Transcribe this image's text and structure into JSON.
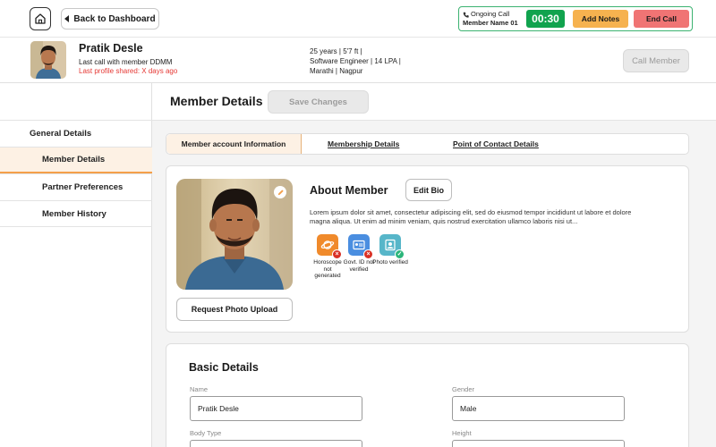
{
  "topbar": {
    "back_label": "Back to Dashboard",
    "call": {
      "status": "Ongoing Call",
      "member_name": "Member Name 01",
      "timer": "00:30",
      "add_notes_label": "Add Notes",
      "end_call_label": "End Call"
    }
  },
  "member": {
    "name": "Pratik Desle",
    "last_call": "Last call with member DDMM",
    "last_shared": "Last profile shared: X days ago",
    "stats_line1": "25 years | 5'7 ft |",
    "stats_line2": "Software Engineer | 14 LPA |",
    "stats_line3": "Marathi | Nagpur",
    "call_member_label": "Call Member"
  },
  "sidebar": {
    "items": [
      {
        "label": "General Details"
      },
      {
        "label": "Member Details"
      },
      {
        "label": "Partner Preferences"
      },
      {
        "label": "Member History"
      }
    ]
  },
  "main": {
    "title": "Member Details",
    "save_label": "Save Changes",
    "tabs": [
      {
        "label": "Member account Information"
      },
      {
        "label": "Membership Details"
      },
      {
        "label": "Point of Contact Details"
      }
    ],
    "about": {
      "title": "About Member",
      "edit_bio_label": "Edit Bio",
      "request_upload_label": "Request Photo Upload",
      "bio": "Lorem ipsum dolor sit amet, consectetur adipiscing elit, sed do eiusmod tempor incididunt ut labore et dolore magna aliqua. Ut enim ad minim veniam, quis nostrud exercitation ullamco laboris nisi ut...",
      "badges": [
        {
          "label": "Horoscope not generated",
          "icon": "horoscope-icon",
          "status": "error"
        },
        {
          "label": "Govt. ID not verified",
          "icon": "id-card-icon",
          "status": "error"
        },
        {
          "label": "Photo verified",
          "icon": "photo-id-icon",
          "status": "ok"
        }
      ]
    },
    "basic": {
      "title": "Basic Details",
      "fields": [
        {
          "label": "Name",
          "value": "Pratik Desle"
        },
        {
          "label": "Gender",
          "value": "Male"
        },
        {
          "label": "Body Type",
          "value": ""
        },
        {
          "label": "Height",
          "value": ""
        }
      ]
    }
  },
  "colors": {
    "accent": "#f4a04a",
    "timer": "#11a34e",
    "end_call": "#f07474",
    "add_notes": "#f6b24f",
    "error_text": "#e53935"
  }
}
